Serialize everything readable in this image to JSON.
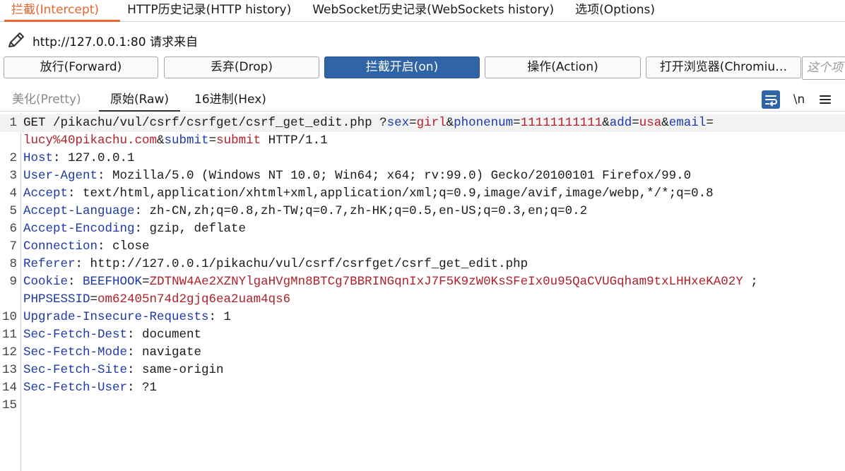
{
  "top_tabs": [
    "拦截(Intercept)",
    "HTTP历史记录(HTTP history)",
    "WebSocket历史记录(WebSockets history)",
    "选项(Options)"
  ],
  "url_label": "http://127.0.0.1:80 请求来自",
  "buttons": {
    "forward": "放行(Forward)",
    "drop": "丢弃(Drop)",
    "intercept": "拦截开启(on)",
    "action": "操作(Action)",
    "browser": "打开浏览器(Chromiu…"
  },
  "search_placeholder": "这个项",
  "view_tabs": [
    "美化(Pretty)",
    "原始(Raw)",
    "16进制(Hex)"
  ],
  "toolbar_newline": "\\n",
  "lines": [
    {
      "n": "1",
      "segs": [
        [
          "t",
          "GET /pikachu/vul/csrf/csrfget/csrf_get_edit.php ?"
        ],
        [
          "k",
          "sex"
        ],
        [
          "t",
          "="
        ],
        [
          "v",
          "girl"
        ],
        [
          "t",
          "&"
        ],
        [
          "k",
          "phonenum"
        ],
        [
          "t",
          "="
        ],
        [
          "v",
          "11111111111"
        ],
        [
          "t",
          "&"
        ],
        [
          "k",
          "add"
        ],
        [
          "t",
          "="
        ],
        [
          "v",
          "usa"
        ],
        [
          "t",
          "&"
        ],
        [
          "k",
          "email"
        ],
        [
          "t",
          "="
        ]
      ]
    },
    {
      "n": "",
      "segs": [
        [
          "v",
          "lucy%40pikachu.com"
        ],
        [
          "t",
          "&"
        ],
        [
          "k",
          "submit"
        ],
        [
          "t",
          "="
        ],
        [
          "v",
          "submit"
        ],
        [
          "t",
          " HTTP/1.1"
        ]
      ]
    },
    {
      "n": "2",
      "segs": [
        [
          "k",
          "Host"
        ],
        [
          "t",
          ": 127.0.0.1"
        ]
      ]
    },
    {
      "n": "3",
      "segs": [
        [
          "k",
          "User-Agent"
        ],
        [
          "t",
          ": Mozilla/5.0 (Windows NT 10.0; Win64; x64; rv:99.0) Gecko/20100101 Firefox/99.0"
        ]
      ]
    },
    {
      "n": "4",
      "segs": [
        [
          "k",
          "Accept"
        ],
        [
          "t",
          ": text/html,application/xhtml+xml,application/xml;q=0.9,image/avif,image/webp,*/*;q=0.8"
        ]
      ]
    },
    {
      "n": "5",
      "segs": [
        [
          "k",
          "Accept-Language"
        ],
        [
          "t",
          ": zh-CN,zh;q=0.8,zh-TW;q=0.7,zh-HK;q=0.5,en-US;q=0.3,en;q=0.2"
        ]
      ]
    },
    {
      "n": "6",
      "segs": [
        [
          "k",
          "Accept-Encoding"
        ],
        [
          "t",
          ": gzip, deflate"
        ]
      ]
    },
    {
      "n": "7",
      "segs": [
        [
          "k",
          "Connection"
        ],
        [
          "t",
          ": close"
        ]
      ]
    },
    {
      "n": "8",
      "segs": [
        [
          "k",
          "Referer"
        ],
        [
          "t",
          ": http://127.0.0.1/pikachu/vul/csrf/csrfget/csrf_get_edit.php"
        ]
      ]
    },
    {
      "n": "9",
      "segs": [
        [
          "k",
          "Cookie"
        ],
        [
          "t",
          ": "
        ],
        [
          "k",
          "BEEFHOOK"
        ],
        [
          "t",
          "="
        ],
        [
          "v",
          "ZDTNW4Ae2XZNYlgaHVgMn8BTCg7BBRINGqnIxJ7F5K9zW0KsSFeIx0u95QaCVUGqham9txLHHxeKA02Y"
        ],
        [
          "t",
          " ;"
        ]
      ]
    },
    {
      "n": "",
      "segs": [
        [
          "k",
          "PHPSESSID"
        ],
        [
          "t",
          "="
        ],
        [
          "v",
          "om62405n74d2gjq6ea2uam4qs6"
        ]
      ]
    },
    {
      "n": "10",
      "segs": [
        [
          "k",
          "Upgrade-Insecure-Requests"
        ],
        [
          "t",
          ": 1"
        ]
      ]
    },
    {
      "n": "11",
      "segs": [
        [
          "k",
          "Sec-Fetch-Dest"
        ],
        [
          "t",
          ": document"
        ]
      ]
    },
    {
      "n": "12",
      "segs": [
        [
          "k",
          "Sec-Fetch-Mode"
        ],
        [
          "t",
          ": navigate"
        ]
      ]
    },
    {
      "n": "13",
      "segs": [
        [
          "k",
          "Sec-Fetch-Site"
        ],
        [
          "t",
          ": same-origin"
        ]
      ]
    },
    {
      "n": "14",
      "segs": [
        [
          "k",
          "Sec-Fetch-User"
        ],
        [
          "t",
          ": ?1"
        ]
      ]
    },
    {
      "n": "15",
      "segs": []
    }
  ]
}
